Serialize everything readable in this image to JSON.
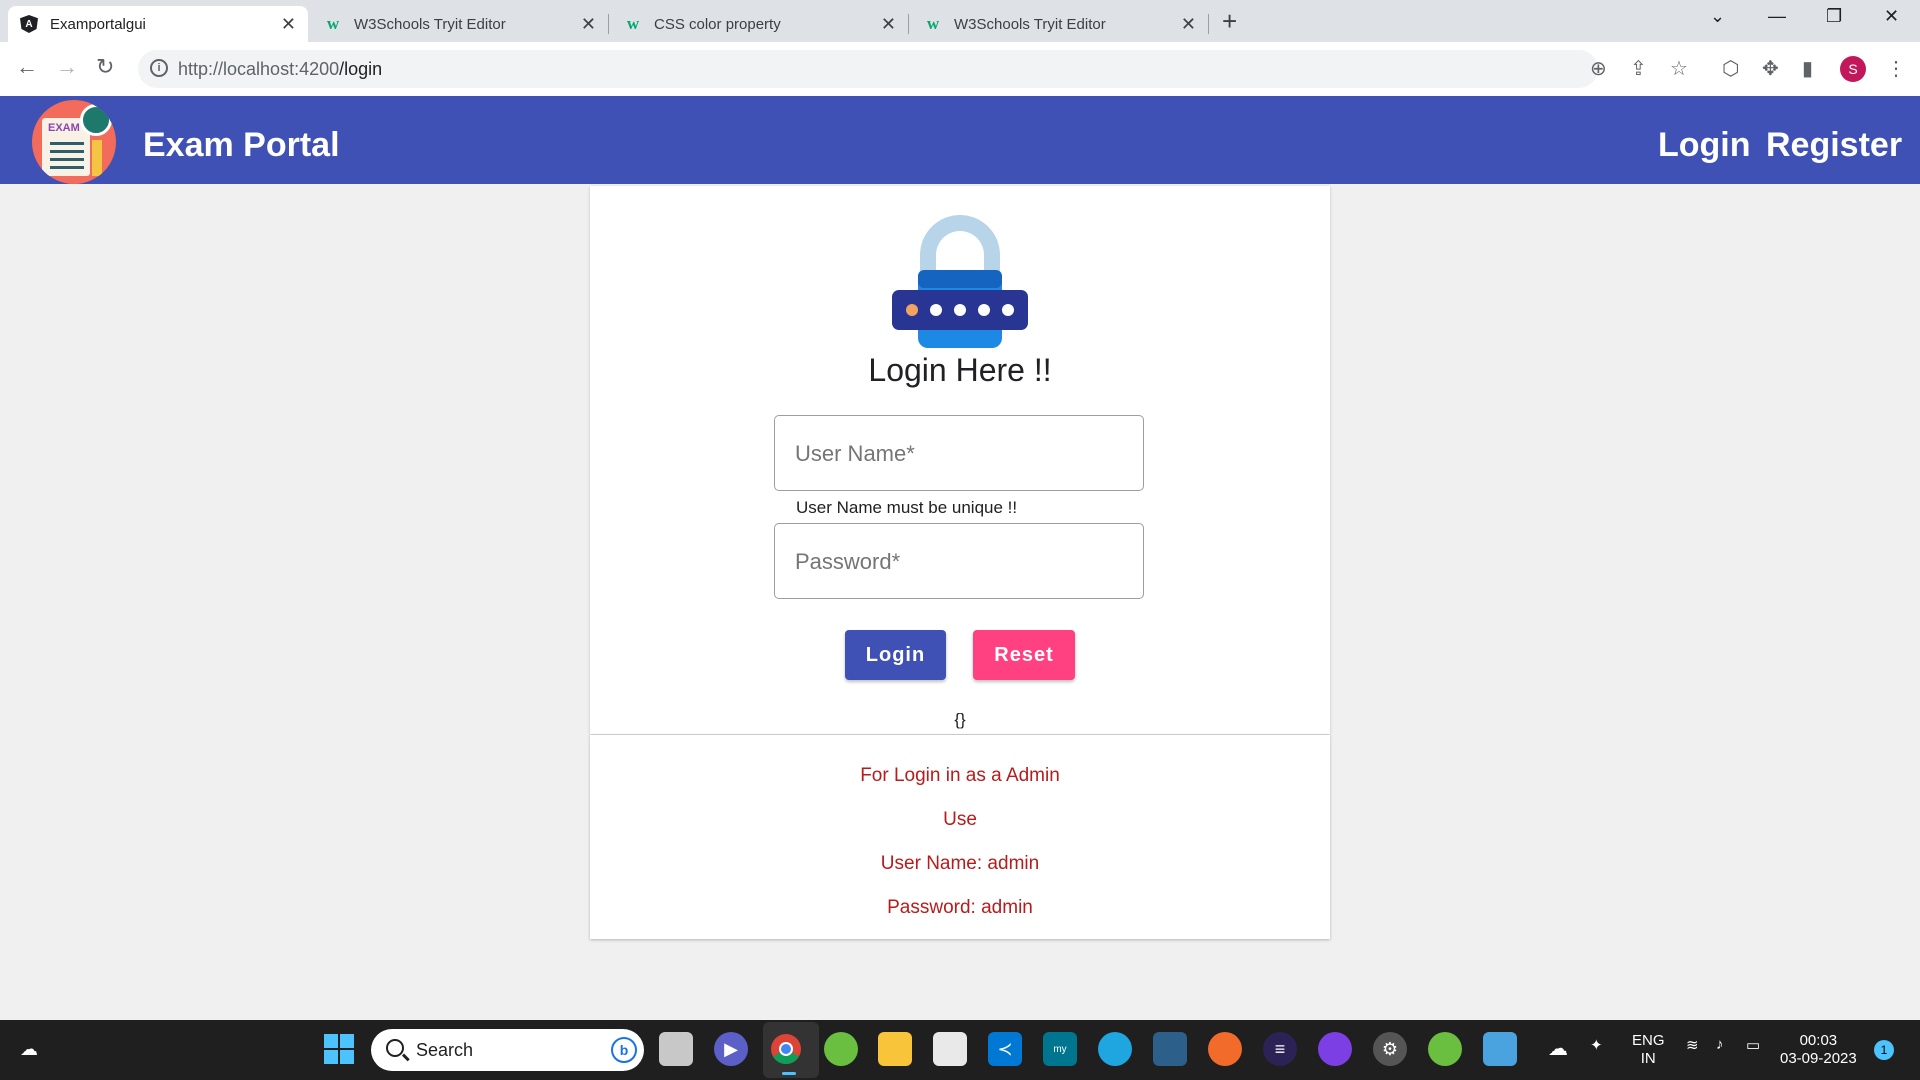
{
  "browser": {
    "tabs": [
      {
        "title": "Examportalgui",
        "icon": "angular-icon"
      },
      {
        "title": "W3Schools Tryit Editor",
        "icon": "w3schools-icon"
      },
      {
        "title": "CSS color property",
        "icon": "w3schools-icon"
      },
      {
        "title": "W3Schools Tryit Editor",
        "icon": "w3schools-icon"
      }
    ],
    "url_host": "http://localhost:4200",
    "url_path": "/login",
    "profile_initial": "S"
  },
  "app": {
    "title": "Exam Portal",
    "logo_text": "EXAM",
    "nav": {
      "login": "Login",
      "register": "Register"
    },
    "primary_color": "#3f51b5",
    "accent_color": "#ff4081"
  },
  "login": {
    "heading": "Login Here !!",
    "username_placeholder": "User Name*",
    "username_hint": "User Name must be unique !!",
    "password_placeholder": "Password*",
    "login_button": "Login",
    "reset_button": "Reset",
    "json_output": "{}"
  },
  "admin_info": {
    "line1": "For Login in as a Admin",
    "line2": "Use",
    "line3": "User Name: admin",
    "line4": "Password: admin"
  },
  "taskbar": {
    "search_label": "Search",
    "language_1": "ENG",
    "language_2": "IN",
    "time": "00:03",
    "date": "03-09-2023",
    "notification_count": "1"
  }
}
